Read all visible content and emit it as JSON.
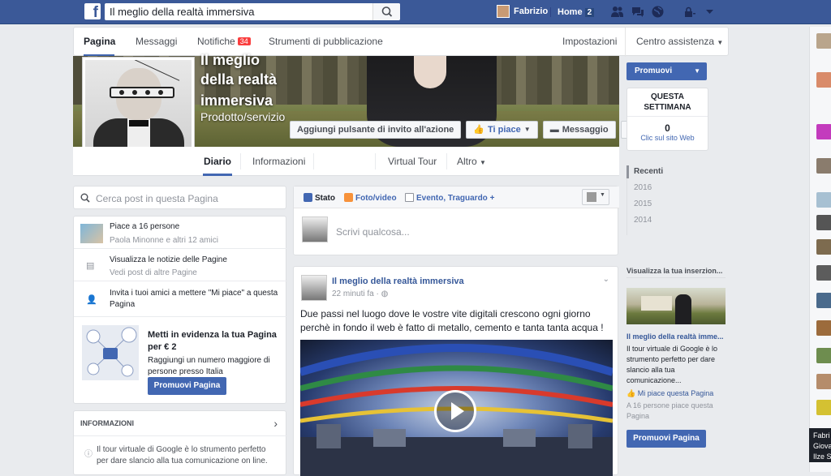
{
  "topbar": {
    "search_value": "Il meglio della realtà immersiva",
    "user_name": "Fabrizio",
    "home_label": "Home",
    "home_count": "2",
    "icons": [
      "friends-icon",
      "messages-icon",
      "globe-icon",
      "lock-icon",
      "chevron-down-icon"
    ]
  },
  "pagenav": {
    "items": [
      "Pagina",
      "Messaggi",
      "Notifiche",
      "Strumenti di pubblicazione"
    ],
    "notif_count": "34",
    "right_items": [
      "Impostazioni",
      "Centro assistenza"
    ]
  },
  "cover": {
    "title_line1": "Il meglio",
    "title_line2": "della realtà",
    "title_line3": "immersiva",
    "category": "Prodotto/servizio",
    "cta_button": "Aggiungi pulsante di invito all'azione",
    "like_button": "Ti piace",
    "message_button": "Messaggio",
    "more_button": "•••"
  },
  "tabs": {
    "items": [
      "Diario",
      "Informazioni",
      "Virtual Tour",
      "Altro"
    ]
  },
  "left": {
    "search_placeholder": "Cerca post in questa Pagina",
    "likes_title": "Piace a 16 persone",
    "likes_sub": "Paola Minonne e altri 12 amici",
    "news_title": "Visualizza le notizie delle Pagine",
    "news_sub": "Vedi post di altre Pagine",
    "invite_text": "Invita i tuoi amici a mettere \"Mi piace\" a questa Pagina",
    "promo_title": "Metti in evidenza la tua Pagina per € 2",
    "promo_text": "Raggiungi un numero maggiore di persone presso Italia",
    "promo_button": "Promuovi Pagina",
    "info_header": "INFORMAZIONI",
    "info_text": "Il tour virtuale di Google è lo strumento perfetto per dare slancio alla tua comunicazione on line."
  },
  "composer": {
    "tabs": [
      "Stato",
      "Foto/video",
      "Evento, Traguardo +"
    ],
    "placeholder": "Scrivi qualcosa..."
  },
  "post": {
    "author": "Il meglio della realtà immersiva",
    "time": "22 minuti fa ·",
    "text": "Due passi nel luogo dove le vostre vite digitali crescono ogni giorno perchè in fondo il web è fatto di metallo, cemento e tanta tanta acqua !"
  },
  "right": {
    "promote_button": "Promuovi",
    "week_title": "QUESTA SETTIMANA",
    "week_value": "0",
    "week_label": "Clic sul sito Web",
    "timeline": [
      "Recenti",
      "2016",
      "2015",
      "2014"
    ],
    "ad_header": "Visualizza la tua inserzion...",
    "ad_title": "Il meglio della realtà imme...",
    "ad_text": "Il tour virtuale di Google è lo strumento perfetto per dare slancio alla tua comunicazione...",
    "ad_like": "Mi piace questa Pagina",
    "ad_likes_count": "A 16 persone piace questa Pagina",
    "ad_button": "Promuovi Pagina"
  },
  "tooltip": {
    "line1": "Fabri",
    "line2": "Giova",
    "line3": "Ilze S"
  },
  "colors": {
    "topbar": "#3b5998",
    "accent": "#4267b2",
    "background": "#e9ebee"
  }
}
